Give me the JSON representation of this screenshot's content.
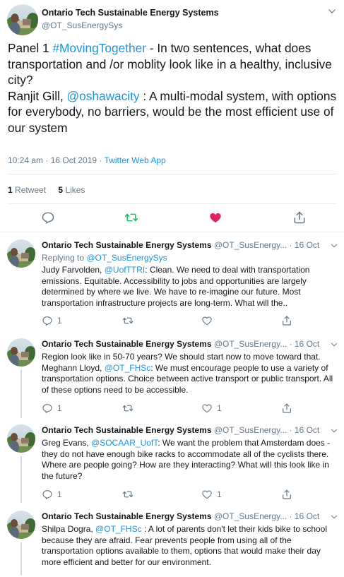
{
  "main_tweet": {
    "author_name": "Ontario Tech Sustainable Energy Systems",
    "author_handle": "@OT_SusEnergySys",
    "text_part1": "Panel 1 ",
    "hashtag": "#MovingTogether",
    "text_part2": " - In two sentences, what does transportation and /or moblity look like in a healthy, inclusive city?",
    "text_part3": "Ranjit Gill, ",
    "mention": "@oshawacity",
    "text_part4": " : A multi-modal system, with options for everybody, no barriers, would be the most efficient use of our system",
    "timestamp": "10:24 am · 16 Oct 2019 · ",
    "source": "Twitter Web App",
    "retweet_count": "1",
    "retweet_label": " Retweet",
    "like_count": "5",
    "like_label": " Likes"
  },
  "replies": [
    {
      "author_name": "Ontario Tech Sustainable Energy Systems",
      "author_handle": "@OT_SusEnergy...",
      "date": " · 16 Oct",
      "replying_to_label": "Replying to ",
      "replying_to_handle": "@OT_SusEnergySys",
      "body_prefix": "Judy Farvolden, ",
      "body_mention": "@UofTTRI",
      "body_rest": ": Clean. We need to deal with transportation emissions. Equitable. Accessibility to jobs and opportunities are largely determined by where we live. We have to re-imagine our future. Most transportation infrastructure projects are long-term. What will the..",
      "reply_count": "1"
    },
    {
      "author_name": "Ontario Tech Sustainable Energy Systems",
      "author_handle": "@OT_SusEnergy...",
      "date": " · 16 Oct",
      "body_line1": "Region look like in 50-70 years? We should start now to move toward that.",
      "body_prefix": "Meghann Lloyd, ",
      "body_mention": "@OT_FHSc",
      "body_rest": ": We must encourage people to use a variety of transportation options. Choice between active transport or public transport. All of these options need to be accessible.",
      "reply_count": "1",
      "like_count": "1"
    },
    {
      "author_name": "Ontario Tech Sustainable Energy Systems",
      "author_handle": "@OT_SusEnergy...",
      "date": " · 16 Oct",
      "body_prefix": "Greg Evans, ",
      "body_mention": "@SOCAAR_UofT",
      "body_rest": ": We want the problem that Amsterdam does - they do not have enough bike racks to accommodate all of the cyclists there. Where are people going? How are they interacting? What will this look like in the future?",
      "reply_count": "1",
      "like_count": "1"
    },
    {
      "author_name": "Ontario Tech Sustainable Energy Systems",
      "author_handle": "@OT_SusEnergy...",
      "date": " · 16 Oct",
      "body_prefix": "Shilpa Dogra, ",
      "body_mention": "@OT_FHSc",
      "body_rest": " : A lot of parents don't let their kids bike to school because they are afraid. Fear prevents people from using all of the transportation options available to them, options that would make their day more efficient and better for our environment."
    }
  ],
  "colors": {
    "link_blue": "#1b95e0",
    "retweet_green": "#17bf63",
    "like_red": "#e0245e",
    "gray_text": "#657786"
  },
  "icons": [
    "reply-icon",
    "retweet-icon",
    "like-icon",
    "share-icon",
    "chevron-down-icon",
    "avatar"
  ]
}
